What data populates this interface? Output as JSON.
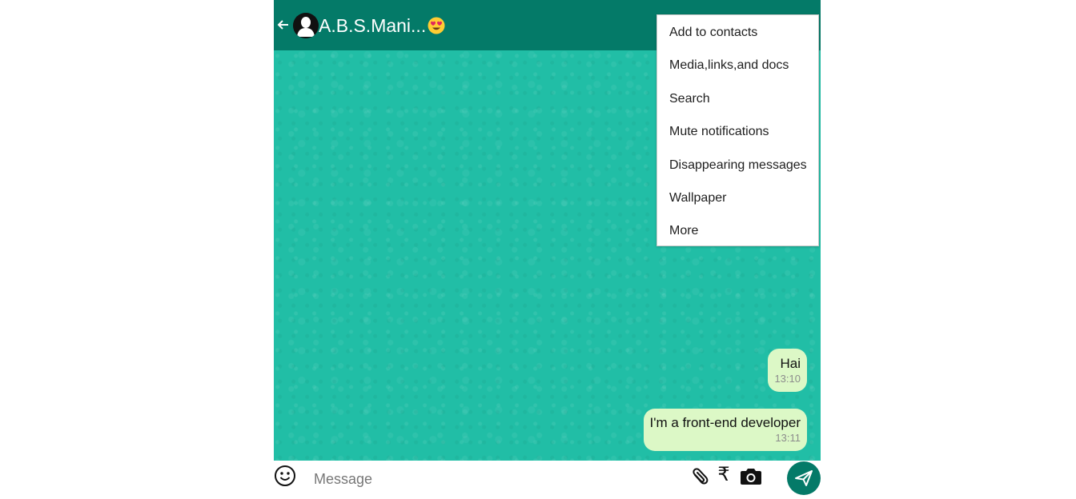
{
  "header": {
    "back_icon": "arrow-left-icon",
    "avatar_icon": "user-avatar-icon",
    "contact_name": "A.B.S.Mani...",
    "contact_emoji": "heart-eyes-emoji-icon",
    "background_color": "#047a68"
  },
  "menu": {
    "items": [
      {
        "label": "Add to contacts"
      },
      {
        "label": "Media,links,and docs"
      },
      {
        "label": "Search"
      },
      {
        "label": "Mute notifications"
      },
      {
        "label": "Disappearing messages"
      },
      {
        "label": "Wallpaper"
      },
      {
        "label": "More"
      }
    ]
  },
  "chat": {
    "wallpaper_color": "#21bea6",
    "bubble_color": "#dcf8c6",
    "messages": [
      {
        "text": "Hai",
        "time": "13:10",
        "outgoing": true
      },
      {
        "text": "I'm a front-end developer",
        "time": "13:11",
        "outgoing": true
      }
    ]
  },
  "footer": {
    "emoji_icon": "smiley-icon",
    "input_placeholder": "Message",
    "input_value": "",
    "attach_icon": "paperclip-icon",
    "rupee_icon": "rupee-icon",
    "rupee_glyph": "₹",
    "camera_icon": "camera-icon",
    "send_icon": "send-icon"
  }
}
